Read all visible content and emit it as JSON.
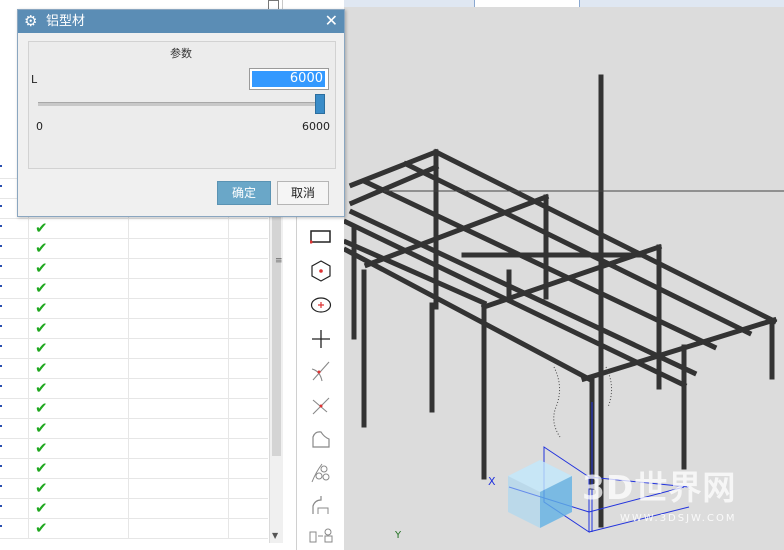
{
  "dialog": {
    "title": "铝型材",
    "group_label": "参数",
    "param_name": "L",
    "param_value": "6000",
    "slider_min": "0",
    "slider_max": "6000",
    "slider_position_fraction": 1.0,
    "ok_label": "确定",
    "cancel_label": "取消",
    "title_bar_color": "#5b8db5",
    "ok_button_color": "#6aa7c8"
  },
  "list": {
    "checked_row_count": 16,
    "check_icon": "check-icon"
  },
  "toolbar": {
    "tools": [
      "rectangle-icon",
      "hexagon-point-icon",
      "ellipse-point-icon",
      "cross-point-icon",
      "tangent-line-icon",
      "normal-line-icon",
      "shape-icon",
      "multi-circle-icon",
      "corner-icon",
      "transform-icon"
    ]
  },
  "viewport": {
    "background_color": "#dcdcdc",
    "frame_color": "#333333",
    "triad": {
      "x_label": "X",
      "y_label": "Y"
    }
  },
  "watermark": {
    "text": "3D世界网",
    "url": "WWW.3DSJW.COM"
  }
}
